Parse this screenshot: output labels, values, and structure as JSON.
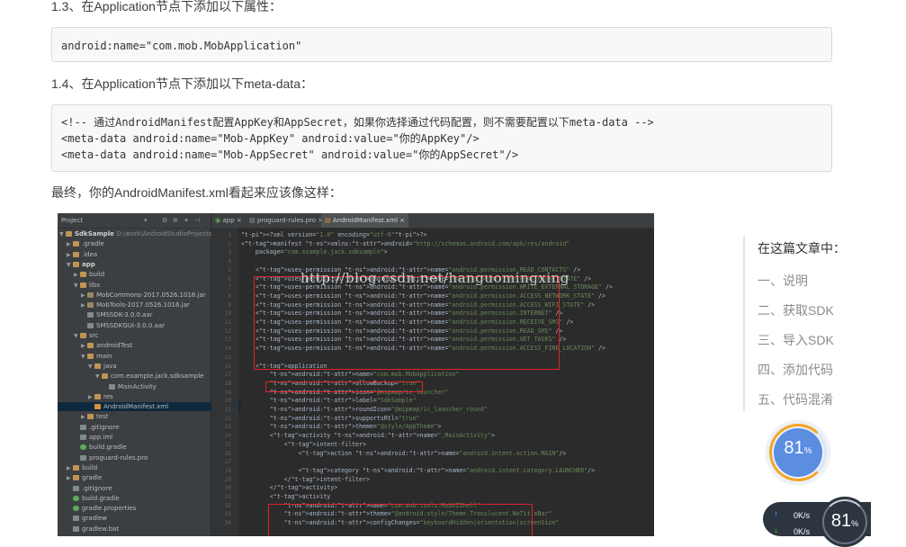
{
  "article": {
    "heading_13": "1.3、在Application节点下添加以下属性：",
    "code_13": "android:name=\"com.mob.MobApplication\"",
    "heading_14": "1.4、在Application节点下添加以下meta-data：",
    "code_14": [
      "<!-- 通过AndroidManifest配置AppKey和AppSecret，如果你选择通过代码配置，则不需要配置以下meta-data -->",
      "<meta-data android:name=\"Mob-AppKey\" android:value=\"你的AppKey\"/>",
      "<meta-data android:name=\"Mob-AppSecret\" android:value=\"你的AppSecret\"/>"
    ],
    "final_text": "最终，你的AndroidManifest.xml看起来应该像这样："
  },
  "ide": {
    "project_label": "Project",
    "tabs": [
      "app",
      "proguard-rules.pro",
      "AndroidManifest.xml"
    ],
    "watermark": "http://blog.csdn.net/hanguomingxing",
    "tree": [
      {
        "label": "SdkSample",
        "icon": "folder",
        "arrow": "▼",
        "bold": true,
        "suffix": " D:\\work\\AndroidStudioProjects\\Sd"
      },
      {
        "label": ".gradle",
        "icon": "folder",
        "arrow": "▶"
      },
      {
        "label": ".idea",
        "icon": "folder",
        "arrow": "▶"
      },
      {
        "label": "app",
        "icon": "folder",
        "arrow": "▼",
        "bold": true
      },
      {
        "label": "build",
        "icon": "folder",
        "arrow": "▶"
      },
      {
        "label": "libs",
        "icon": "folder",
        "arrow": "▼"
      },
      {
        "label": "MobCommons-2017.0526.1016.jar",
        "icon": "jar",
        "arrow": "▶"
      },
      {
        "label": "MobTools-2017.0526.1016.jar",
        "icon": "jar",
        "arrow": "▶"
      },
      {
        "label": "SMSSDK-3.0.0.aar",
        "icon": "file",
        "arrow": ""
      },
      {
        "label": "SMSSDKGUI-3.0.0.aar",
        "icon": "file",
        "arrow": ""
      },
      {
        "label": "src",
        "icon": "folder",
        "arrow": "▼"
      },
      {
        "label": "androidTest",
        "icon": "folder",
        "arrow": "▶"
      },
      {
        "label": "main",
        "icon": "folder",
        "arrow": "▼"
      },
      {
        "label": "java",
        "icon": "folder",
        "arrow": "▼"
      },
      {
        "label": "com.example.jack.sdksample",
        "icon": "folder",
        "arrow": "▼"
      },
      {
        "label": "MainActivity",
        "icon": "file",
        "arrow": ""
      },
      {
        "label": "res",
        "icon": "folder",
        "arrow": "▶"
      },
      {
        "label": "AndroidManifest.xml",
        "icon": "xml",
        "arrow": "",
        "selected": true
      },
      {
        "label": "test",
        "icon": "folder",
        "arrow": "▶"
      },
      {
        "label": ".gitignore",
        "icon": "file",
        "arrow": ""
      },
      {
        "label": "app.iml",
        "icon": "file",
        "arrow": ""
      },
      {
        "label": "build.gradle",
        "icon": "gradle",
        "arrow": ""
      },
      {
        "label": "proguard-rules.pro",
        "icon": "file",
        "arrow": ""
      },
      {
        "label": "build",
        "icon": "folder",
        "arrow": "▶"
      },
      {
        "label": "gradle",
        "icon": "folder",
        "arrow": "▶"
      },
      {
        "label": ".gitignore",
        "icon": "file",
        "arrow": ""
      },
      {
        "label": "build.gradle",
        "icon": "gradle",
        "arrow": ""
      },
      {
        "label": "gradle.properties",
        "icon": "gradle",
        "arrow": ""
      },
      {
        "label": "gradlew",
        "icon": "file",
        "arrow": ""
      },
      {
        "label": "gradlew.bat",
        "icon": "file",
        "arrow": ""
      }
    ],
    "code_lines": [
      "<?xml version=\"1.0\" encoding=\"utf-8\"?>",
      "<manifest xmlns:android=\"http://schemas.android.com/apk/res/android\"",
      "    package=\"com.example.jack.sdksample\">",
      "",
      "    <uses-permission android:name=\"android.permission.READ_CONTACTS\" />",
      "    <uses-permission android:name=\"android.permission.READ_PHONE_STATE\" />",
      "    <uses-permission android:name=\"android.permission.WRITE_EXTERNAL_STORAGE\" />",
      "    <uses-permission android:name=\"android.permission.ACCESS_NETWORK_STATE\" />",
      "    <uses-permission android:name=\"android.permission.ACCESS_WIFI_STATE\" />",
      "    <uses-permission android:name=\"android.permission.INTERNET\" />",
      "    <uses-permission android:name=\"android.permission.RECEIVE_SMS\" />",
      "    <uses-permission android:name=\"android.permission.READ_SMS\" />",
      "    <uses-permission android:name=\"android.permission.GET_TASKS\" />",
      "    <uses-permission android:name=\"android.permission.ACCESS_FINE_LOCATION\" />",
      "",
      "    <application",
      "        android:name=\"com.mob.MobApplication\"",
      "        android:allowBackup=\"true\"",
      "        android:icon=\"@mipmap/ic_launcher\"",
      "        android:label=\"SdkSample\"",
      "        android:roundIcon=\"@mipmap/ic_launcher_round\"",
      "        android:supportsRtl=\"true\"",
      "        android:theme=\"@style/AppTheme\">",
      "        <activity android:name=\".MainActivity\">",
      "            <intent-filter>",
      "                <action android:name=\"android.intent.action.MAIN\"/>",
      "",
      "                <category android:name=\"android.intent.category.LAUNCHER\"/>",
      "            </intent-filter>",
      "        </activity>",
      "        <activity",
      "            android:name=\"com.mob.tools.MobUIShell\"",
      "            android:theme=\"@android:style/Theme.Translucent.NoTitleBar\"",
      "            android:configChanges=\"keyboardHidden|orientation|screenSize\""
    ]
  },
  "toc": {
    "title": "在这篇文章中：",
    "items": [
      "一、说明",
      "二、获取SDK",
      "三、导入SDK",
      "四、添加代码",
      "五、代码混淆"
    ]
  },
  "widgets": {
    "score_big": "81",
    "score_small": "81",
    "pct_sign": "%",
    "net_up": "0K/s",
    "net_down": "0K/s"
  },
  "colors": {
    "red_box": "#e0242b",
    "ide_bg": "#2b2b2b",
    "tag": "#e8bf6a",
    "value": "#6a8759"
  }
}
